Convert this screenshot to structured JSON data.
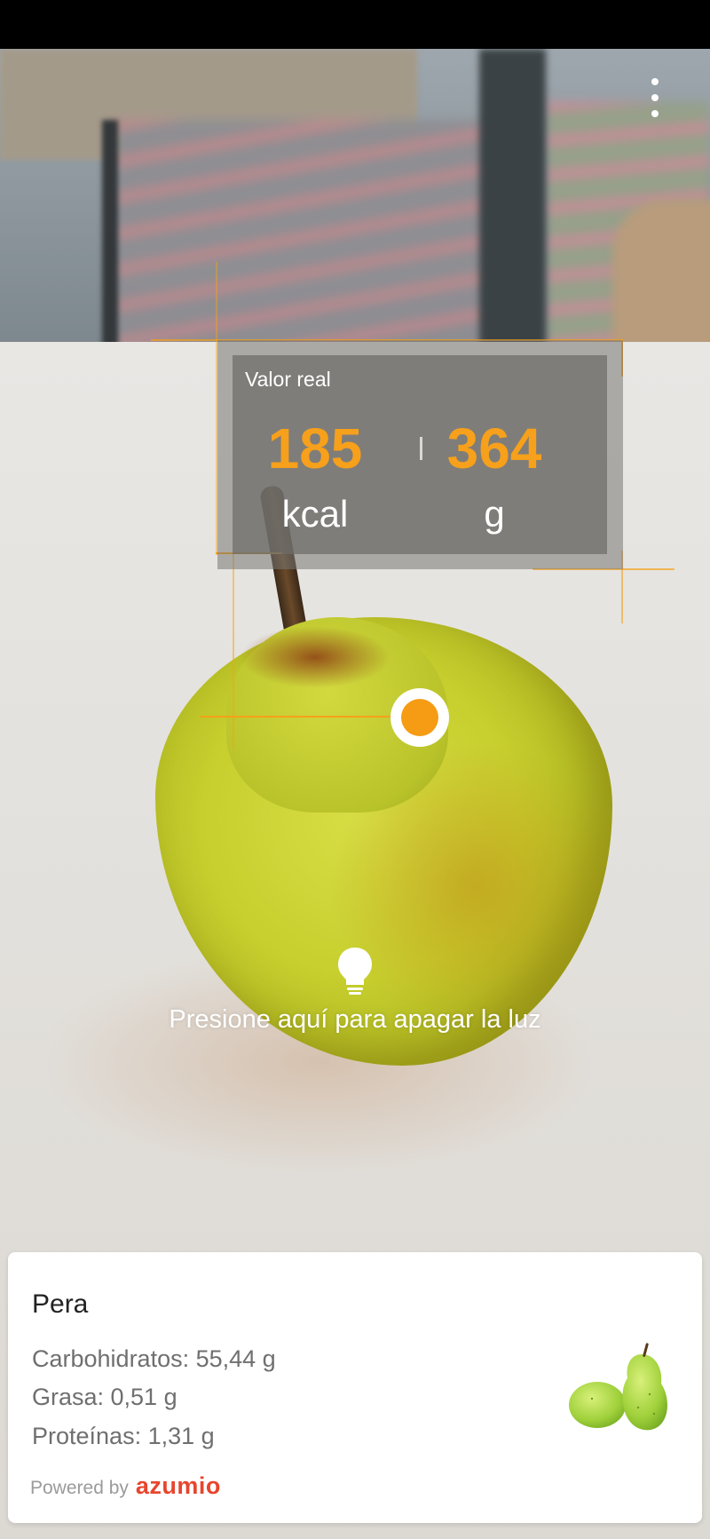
{
  "panel": {
    "title": "Valor real",
    "calories_value": "185",
    "calories_unit": "kcal",
    "weight_value": "364",
    "weight_unit": "g"
  },
  "light_toggle": {
    "label": "Presione aquí para apagar la luz",
    "icon": "lightbulb-icon"
  },
  "menu": {
    "icon": "more-vert-icon"
  },
  "food_card": {
    "name": "Pera",
    "nutrients": [
      "Carbohidratos: 55,44 g",
      "Grasa: 0,51 g",
      "Proteínas: 1,31 g"
    ],
    "powered_by": "Powered by",
    "brand": "azumio"
  },
  "colors": {
    "accent": "#f59c14",
    "brand": "#e8452e"
  }
}
